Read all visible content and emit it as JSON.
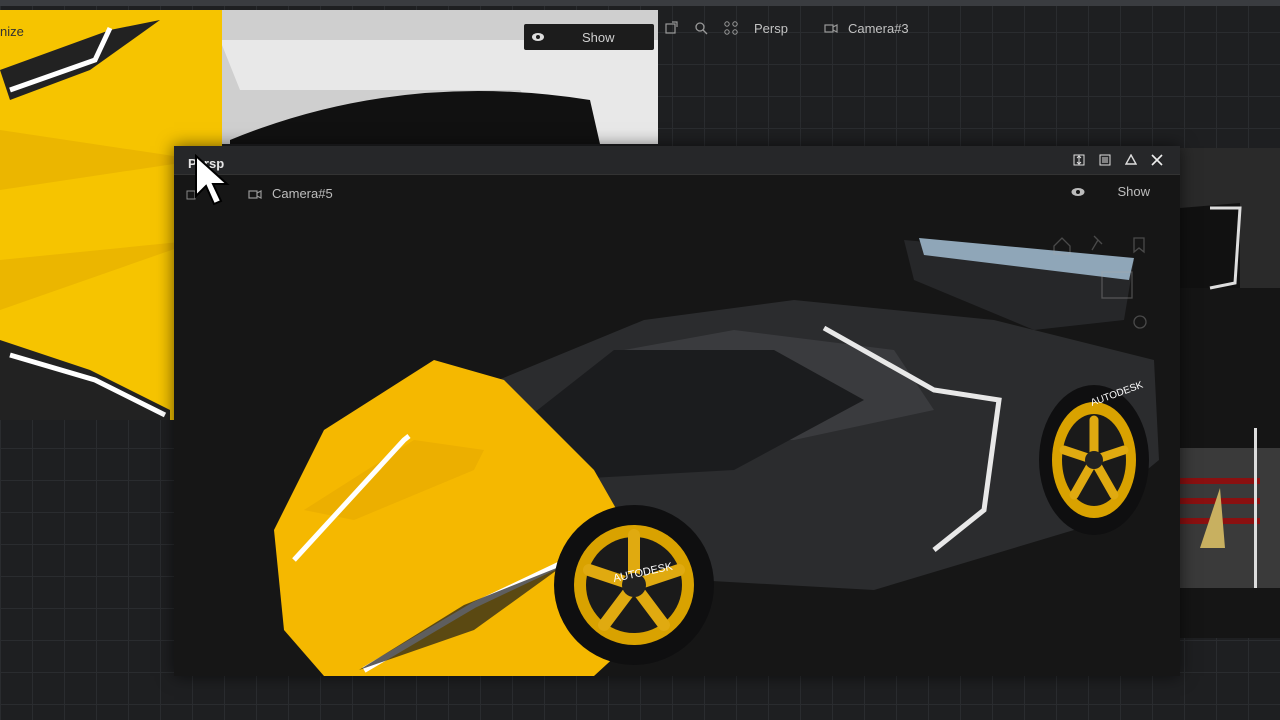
{
  "background_viewport": {
    "title_fragment": "nize",
    "show_label": "Show",
    "toolbar": {
      "view_label": "Persp",
      "camera_label": "Camera#3"
    }
  },
  "persp_window": {
    "title": "Persp",
    "camera_label": "Camera#5",
    "show_label": "Show"
  },
  "car": {
    "brand_text": "AUTODESK",
    "body_color": "#f5b800",
    "dark_color": "#2a2b2d"
  },
  "colors": {
    "background": "#1e1f21",
    "window_bg": "#161616",
    "titlebar": "#262729"
  }
}
